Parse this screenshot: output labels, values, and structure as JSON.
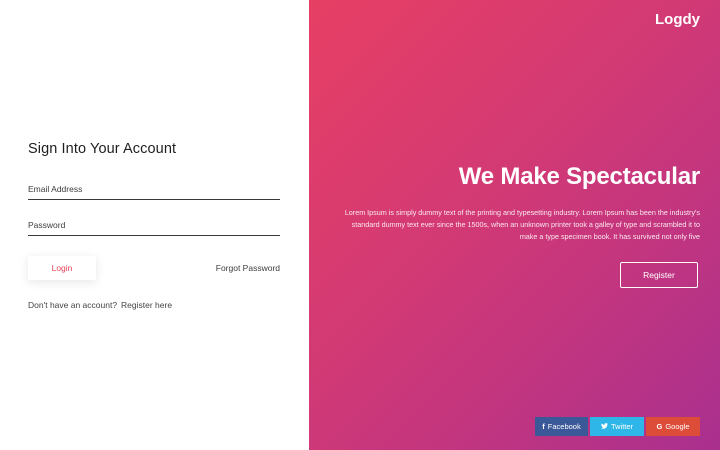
{
  "brand": "Logdy",
  "form": {
    "title": "Sign Into Your Account",
    "email_placeholder": "Email Address",
    "password_placeholder": "Password",
    "login_label": "Login",
    "forgot_label": "Forgot Password",
    "no_account_text": "Don't have an account?",
    "register_link": "Register here"
  },
  "hero": {
    "headline": "We Make Spectacular",
    "description": "Lorem Ipsum is simply dummy text of the printing and typesetting industry. Lorem Ipsum has been the industry's standard dummy text ever since the 1500s, when an unknown printer took a galley of type and scrambled it to make a type specimen book. It has survived not only five",
    "register_label": "Register"
  },
  "social": {
    "facebook_label": "Facebook",
    "twitter_label": "Twitter",
    "google_label": "Google",
    "facebook_icon": "facebook-icon",
    "twitter_icon": "twitter-icon",
    "google_icon": "google-icon"
  },
  "colors": {
    "gradient_start": "#e73f64",
    "gradient_end": "#a9308f",
    "login_text": "#e64257",
    "facebook": "#3b5998",
    "twitter": "#2eb6e8",
    "google": "#dd4b39"
  }
}
